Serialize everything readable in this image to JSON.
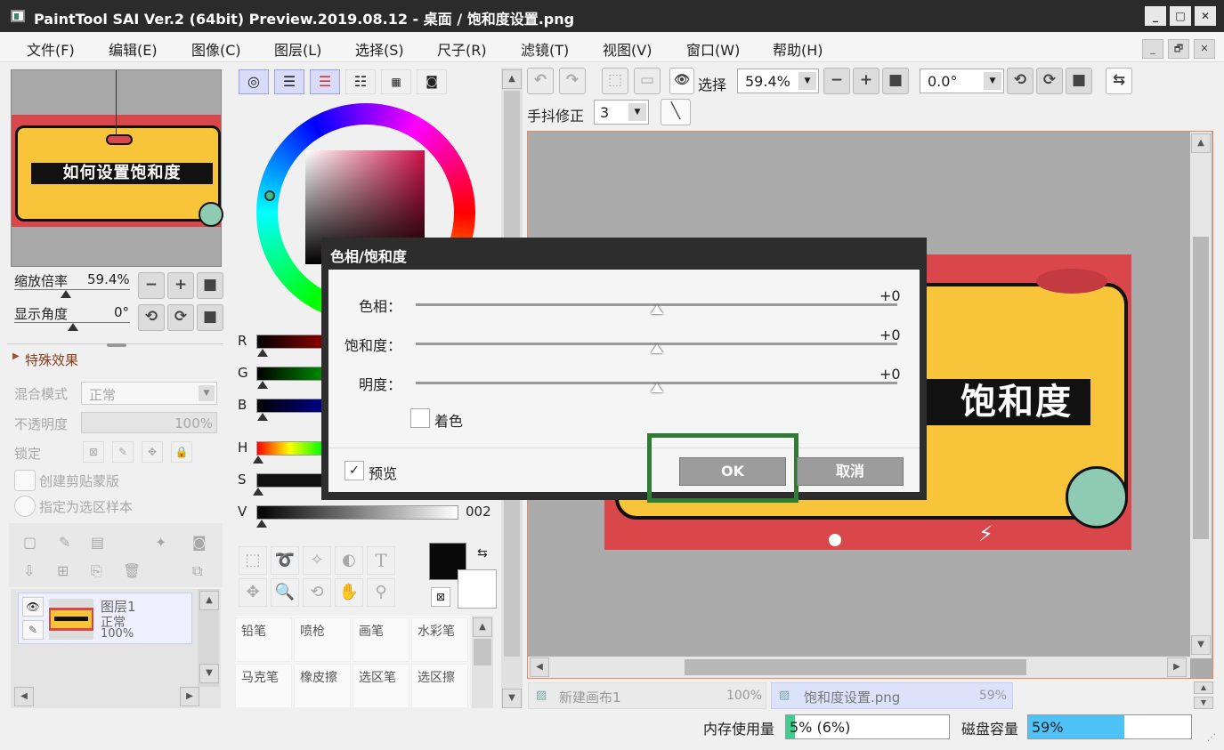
{
  "window": {
    "title": "PaintTool SAI Ver.2 (64bit) Preview.2019.08.12 - 桌面 / 饱和度设置.png",
    "controls": [
      "_",
      "□",
      "✕"
    ]
  },
  "menu": {
    "items": [
      "文件(F)",
      "编辑(E)",
      "图像(C)",
      "图层(L)",
      "选择(S)",
      "尺子(R)",
      "滤镜(T)",
      "视图(V)",
      "窗口(W)",
      "帮助(H)"
    ],
    "mdi_controls": [
      "_",
      "🗗",
      "✕"
    ]
  },
  "navigator": {
    "banner_text": "如何设置饱和度",
    "zoom_label": "缩放倍率",
    "zoom_value": "59.4%",
    "angle_label": "显示角度",
    "angle_value": "0°"
  },
  "layer_panel": {
    "effects_label": "特殊效果",
    "blend_label": "混合模式",
    "blend_value": "正常",
    "opacity_label": "不透明度",
    "opacity_value": "100%",
    "lock_label": "锁定",
    "clip_label": "创建剪贴蒙版",
    "sample_label": "指定为选区样本",
    "layer": {
      "name": "图层1",
      "mode": "正常",
      "opacity": "100%"
    }
  },
  "color_panel": {
    "rgb_labels": [
      "R",
      "G",
      "B"
    ],
    "hsv_labels": [
      "H",
      "S",
      "V"
    ],
    "v_value": "002"
  },
  "tools": {
    "brushes": [
      {
        "name": "铅笔"
      },
      {
        "name": "喷枪"
      },
      {
        "name": "画笔"
      },
      {
        "name": "水彩笔"
      },
      {
        "name": "马克笔"
      },
      {
        "name": "橡皮擦"
      },
      {
        "name": "选区笔"
      },
      {
        "name": "选区擦"
      }
    ],
    "text_tool": "T"
  },
  "canvas_toolbar": {
    "select_label": "选择",
    "zoom_value": "59.4%",
    "angle_value": "0.0°",
    "stabilizer_label": "手抖修正",
    "stabilizer_value": "3"
  },
  "canvas": {
    "banner_text": "饱和度"
  },
  "dialog": {
    "title": "色相/饱和度",
    "rows": [
      {
        "label": "色相：",
        "value": "+0",
        "level": 0
      },
      {
        "label": "饱和度：",
        "value": "+0",
        "level": 0
      },
      {
        "label": "明度：",
        "value": "+0",
        "level": 0
      }
    ],
    "colorize_label": "着色",
    "colorize_checked": false,
    "preview_label": "预览",
    "preview_checked": true,
    "ok_label": "OK",
    "cancel_label": "取消",
    "highlight_color": "#2e7d32"
  },
  "tabs": [
    {
      "name": "新建画布1",
      "zoom": "100%"
    },
    {
      "name": "饱和度设置.png",
      "zoom": "59%"
    }
  ],
  "status": {
    "memory_label": "内存使用量",
    "memory_value": "5% (6%)",
    "memory_level": 0.05,
    "disk_label": "磁盘容量",
    "disk_value": "59%",
    "disk_level": 0.59
  },
  "colors": {
    "banner_yellow": "#f7c43a",
    "banner_red": "#d9474b",
    "disk_bar": "#4fc3f7",
    "memory_bar": "#3ecf8e"
  }
}
